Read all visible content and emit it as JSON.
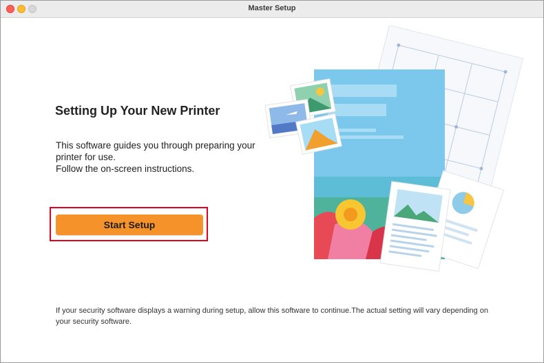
{
  "window": {
    "title": "Master Setup",
    "controls": [
      "close",
      "minimize",
      "zoom"
    ]
  },
  "main": {
    "heading": "Setting Up Your New Printer",
    "description_lines": [
      "This software guides you through preparing your printer for use.",
      "Follow the on-screen instructions."
    ],
    "start_button_label": "Start Setup"
  },
  "footer": {
    "note": "If your security software displays a warning during setup, allow this software to continue.The actual setting will vary depending on your security software."
  },
  "illustration": {
    "name": "printer-setup-illustration-icon"
  },
  "colors": {
    "button": "#f6922a",
    "highlight_border": "#e2001a",
    "brochure_blue": "#7cc7ec"
  }
}
